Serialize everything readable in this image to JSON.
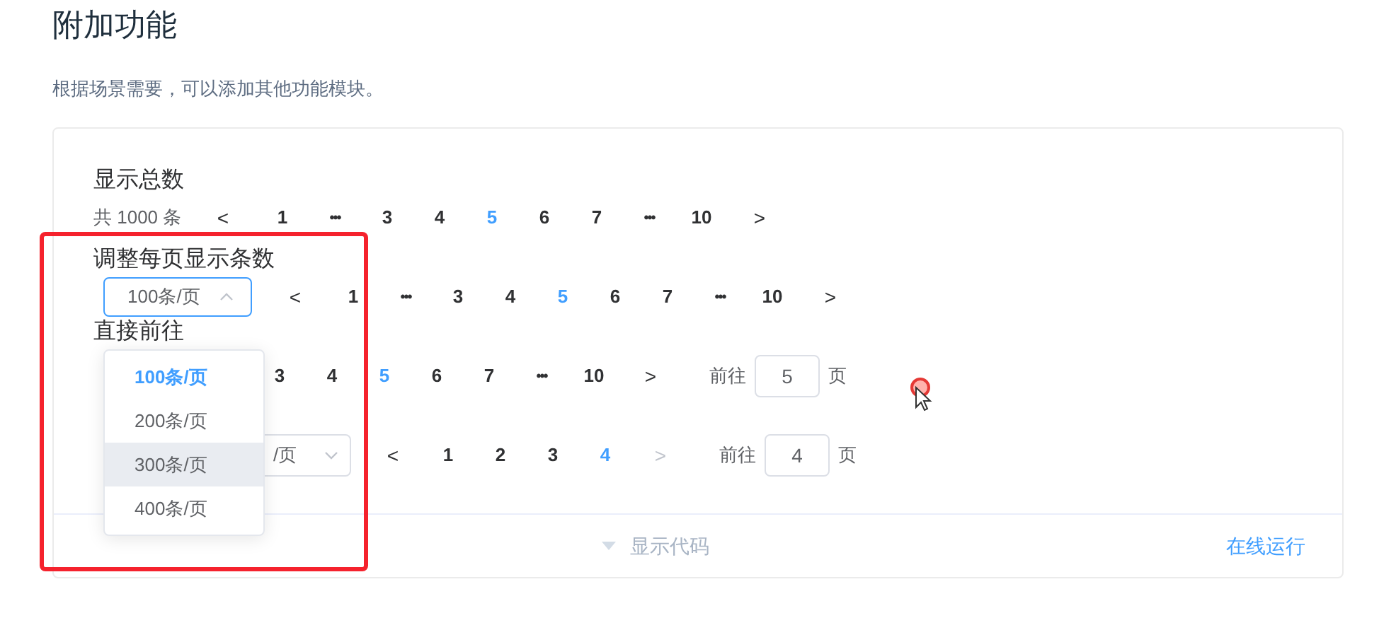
{
  "heading": "附加功能",
  "description": "根据场景需要，可以添加其他功能模块。",
  "sections": [
    {
      "title": "显示总数",
      "total": "共 1000 条",
      "prev": {
        "label": "<",
        "disabled": false
      },
      "pages": [
        {
          "label": "1",
          "kind": "page",
          "selected": false
        },
        {
          "label": "•••",
          "kind": "ellipsis",
          "selected": false
        },
        {
          "label": "3",
          "kind": "page",
          "selected": false
        },
        {
          "label": "4",
          "kind": "page",
          "selected": false
        },
        {
          "label": "5",
          "kind": "page",
          "selected": true
        },
        {
          "label": "6",
          "kind": "page",
          "selected": false
        },
        {
          "label": "7",
          "kind": "page",
          "selected": false
        },
        {
          "label": "•••",
          "kind": "ellipsis",
          "selected": false
        },
        {
          "label": "10",
          "kind": "page",
          "selected": false
        }
      ],
      "next": {
        "label": ">",
        "disabled": false
      }
    },
    {
      "title": "调整每页显示条数",
      "size_select": {
        "value": "100条/页",
        "expanded": true
      },
      "prev": {
        "label": "<",
        "disabled": false
      },
      "pages": [
        {
          "label": "1",
          "kind": "page",
          "selected": false
        },
        {
          "label": "•••",
          "kind": "ellipsis",
          "selected": false
        },
        {
          "label": "3",
          "kind": "page",
          "selected": false
        },
        {
          "label": "4",
          "kind": "page",
          "selected": false
        },
        {
          "label": "5",
          "kind": "page",
          "selected": true
        },
        {
          "label": "6",
          "kind": "page",
          "selected": false
        },
        {
          "label": "7",
          "kind": "page",
          "selected": false
        },
        {
          "label": "•••",
          "kind": "ellipsis",
          "selected": false
        },
        {
          "label": "10",
          "kind": "page",
          "selected": false
        }
      ],
      "next": {
        "label": ">",
        "disabled": false
      }
    },
    {
      "title": "直接前往",
      "pages": [
        {
          "label": "3",
          "kind": "page",
          "selected": false
        },
        {
          "label": "4",
          "kind": "page",
          "selected": false
        },
        {
          "label": "5",
          "kind": "page",
          "selected": true
        },
        {
          "label": "6",
          "kind": "page",
          "selected": false
        },
        {
          "label": "7",
          "kind": "page",
          "selected": false
        },
        {
          "label": "•••",
          "kind": "ellipsis",
          "selected": false
        },
        {
          "label": "10",
          "kind": "page",
          "selected": false
        }
      ],
      "next": {
        "label": ">",
        "disabled": false
      },
      "jump": {
        "before": "前往",
        "value": "5",
        "after": "页"
      }
    },
    {
      "size_select": {
        "value": "/页",
        "expanded": false
      },
      "prev": {
        "label": "<",
        "disabled": false
      },
      "pages": [
        {
          "label": "1",
          "kind": "page",
          "selected": false
        },
        {
          "label": "2",
          "kind": "page",
          "selected": false
        },
        {
          "label": "3",
          "kind": "page",
          "selected": false
        },
        {
          "label": "4",
          "kind": "page",
          "selected": true
        }
      ],
      "next": {
        "label": ">",
        "disabled": true
      },
      "jump": {
        "before": "前往",
        "value": "4",
        "after": "页"
      }
    }
  ],
  "dropdown": [
    {
      "label": "100条/页",
      "selected": true,
      "hovered": false
    },
    {
      "label": "200条/页",
      "selected": false,
      "hovered": false
    },
    {
      "label": "300条/页",
      "selected": false,
      "hovered": true
    },
    {
      "label": "400条/页",
      "selected": false,
      "hovered": false
    }
  ],
  "footer": {
    "toggle": "显示代码",
    "run": "在线运行"
  }
}
